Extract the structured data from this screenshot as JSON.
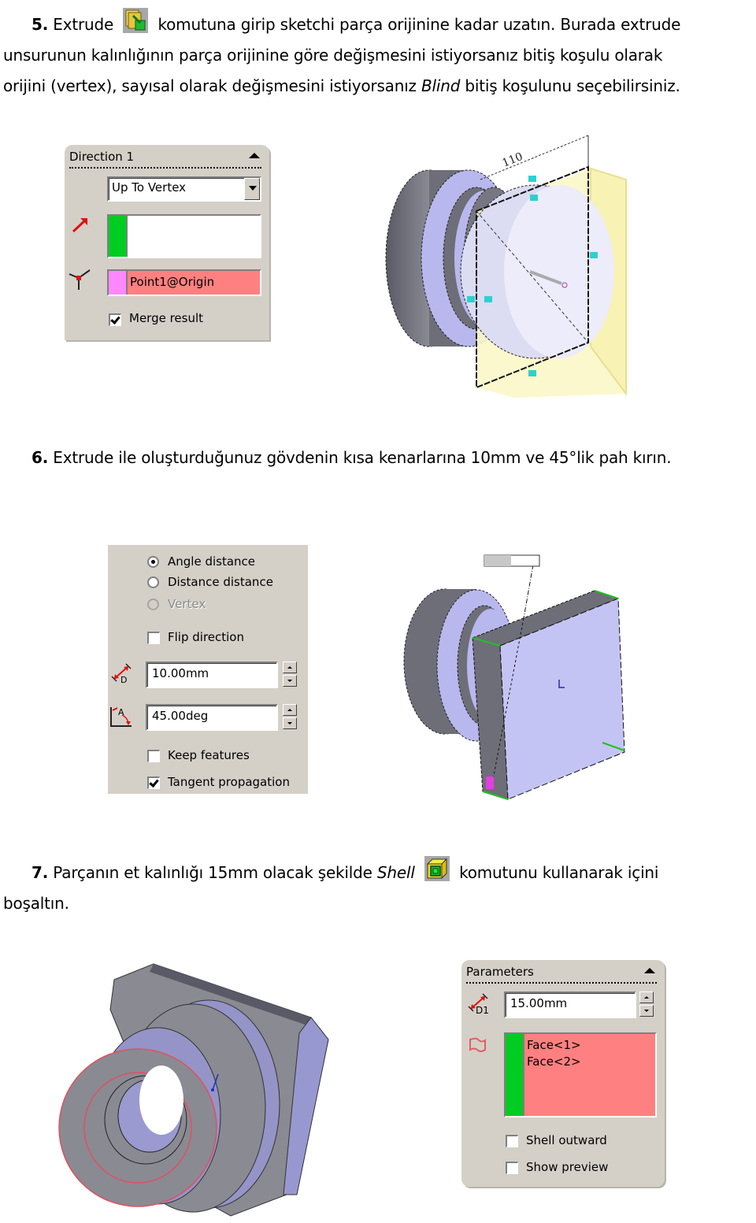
{
  "step5": {
    "number": "5.",
    "before_icon": "Extrude",
    "icon": "extrude-icon",
    "after_icon": "komutuna girip sketchi parça orijinine kadar uzatın. Burada extrude",
    "line2": "unsurunun kalınlığının parça orijinine göre değişmesini istiyorsanız bitiş koşulu olarak",
    "line3_before": "orijini (vertex), sayısal olarak değişmesini istiyorsanız ",
    "line3_italic": "Blind",
    "line3_after": " bitiş koşulunu seçebilirsiniz.",
    "panel": {
      "title": "Direction 1",
      "end_condition": "Up To Vertex",
      "direction_selection": "",
      "vertex_selection": "Point1@Origin",
      "merge_result_label": "Merge result",
      "merge_result_checked": true,
      "colors": {
        "direction_swatch": "#00cc22",
        "vertex_swatch": "#ff88ff",
        "selected_field": "#ff8080"
      }
    },
    "figure": {
      "dimension_label": "110",
      "description": "extrude preview of part up to origin vertex"
    }
  },
  "step6": {
    "number": "6.",
    "text": "Extrude ile oluşturduğunuz gövdenin kısa kenarlarına 10mm ve 45°lik pah kırın.",
    "panel": {
      "options": [
        {
          "label": "Angle distance",
          "selected": true,
          "disabled": false
        },
        {
          "label": "Distance distance",
          "selected": false,
          "disabled": false
        },
        {
          "label": "Vertex",
          "selected": false,
          "disabled": true
        }
      ],
      "flip_direction_label": "Flip direction",
      "flip_direction_checked": false,
      "distance_value": "10.00mm",
      "distance_icon_label": "D",
      "angle_value": "45.00deg",
      "angle_icon_label": "A",
      "keep_features_label": "Keep features",
      "keep_features_checked": false,
      "tangent_propagation_label": "Tangent propagation",
      "tangent_propagation_checked": true
    },
    "figure": {
      "description": "chamfer preview on square body edges"
    }
  },
  "step7": {
    "number": "7.",
    "before_icon": "Parçanın et kalınlığı 15mm olacak şekilde ",
    "italic": "Shell",
    "icon": "shell-icon",
    "after_icon": "komutunu kullanarak içini",
    "line2": "boşaltın.",
    "panel": {
      "title": "Parameters",
      "thickness_value": "15.00mm",
      "thickness_icon_label": "D1",
      "faces": [
        "Face<1>",
        "Face<2>"
      ],
      "shell_outward_label": "Shell outward",
      "shell_outward_checked": false,
      "show_preview_label": "Show preview",
      "show_preview_checked": false,
      "colors": {
        "faces_swatch": "#00cc22",
        "faces_field": "#ff8080"
      }
    },
    "figure": {
      "description": "shelled part with hollow interior"
    }
  }
}
